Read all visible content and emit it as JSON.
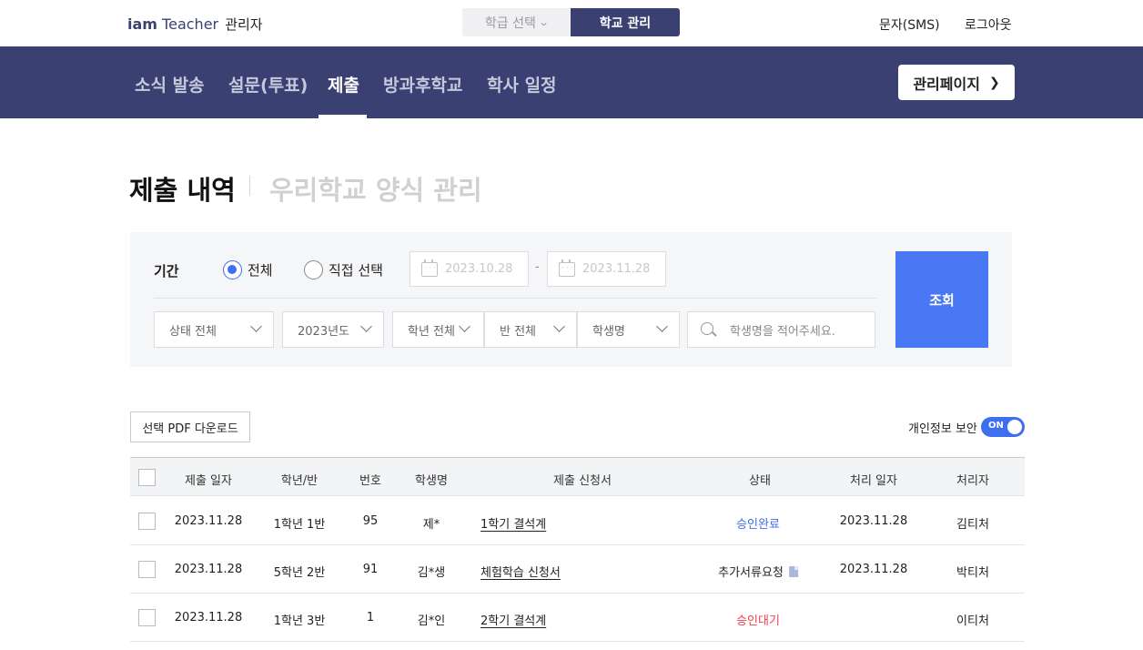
{
  "brand": {
    "iam": "iam",
    "teacher": "Teacher",
    "admin": "관리자"
  },
  "top": {
    "grade_select": "학급 선택",
    "school_manage": "학교 관리",
    "sms": "문자(SMS)",
    "logout": "로그아웃"
  },
  "nav": {
    "items": [
      "소식 발송",
      "설문(투표)",
      "제출",
      "방과후학교",
      "학사 일정"
    ],
    "active_index": 2,
    "admin_page": "관리페이지"
  },
  "page": {
    "title": "제출 내역",
    "alt_title": "우리학교 양식 관리"
  },
  "filter": {
    "period_label": "기간",
    "radio_all": "전체",
    "radio_custom": "직접 선택",
    "selected": "전체",
    "date_from": "2023.10.28",
    "date_to": "2023.11.28",
    "date_sep": "-",
    "selects": [
      "상태 전체",
      "2023년도",
      "학년 전체",
      "반 전체",
      "학생명"
    ],
    "search_placeholder": "학생명을 적어주세요.",
    "query_button": "조회"
  },
  "actions": {
    "pdf_download": "선택 PDF 다운로드",
    "privacy_label": "개인정보 보안",
    "privacy_toggle": "ON"
  },
  "table": {
    "headers": [
      "제출 일자",
      "학년/반",
      "번호",
      "학생명",
      "제출 신청서",
      "상태",
      "처리 일자",
      "처리자"
    ],
    "rows": [
      {
        "date": "2023.11.28",
        "class": "1학년 1반",
        "num": "95",
        "name": "제*",
        "doc": "1학기 결석계",
        "status": "승인완료",
        "proc_date": "2023.11.28",
        "handler": "김티처"
      },
      {
        "date": "2023.11.28",
        "class": "5학년 2반",
        "num": "91",
        "name": "김*생",
        "doc": "체험학습 신청서",
        "status": "추가서류요청",
        "proc_date": "2023.11.28",
        "handler": "박티처"
      },
      {
        "date": "2023.11.28",
        "class": "1학년 3반",
        "num": "1",
        "name": "김*인",
        "doc": "2학기 결석계",
        "status": "승인대기",
        "proc_date": "",
        "handler": "이티처"
      }
    ]
  },
  "colors": {
    "navy": "#3b4073",
    "accent_blue": "#4a78f5",
    "status_approved": "#3e6ff0",
    "status_pending": "#f0404f"
  }
}
